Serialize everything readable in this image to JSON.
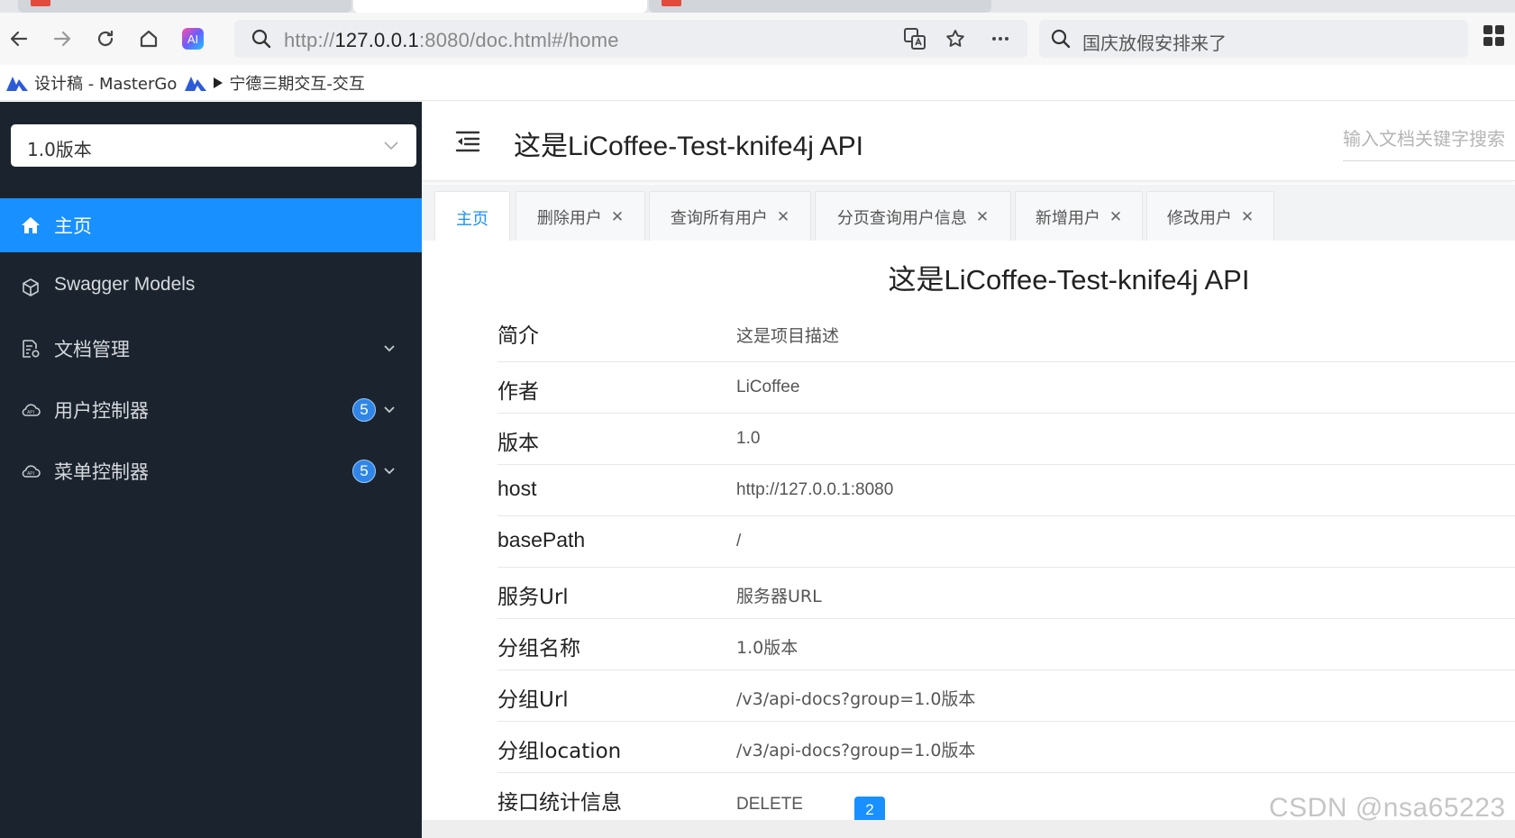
{
  "browser": {
    "url_prefix": "http://",
    "url_host": "127.0.0.1",
    "url_rest": ":8080/doc.html#/home",
    "search_text": "国庆放假安排来了",
    "extension_icon": "ai-extension-icon",
    "bookmarks": [
      {
        "label": "设计稿 - MasterGo",
        "icon": "mastergo-logo"
      },
      {
        "label": "宁德三期交互-交互",
        "icon": "mastergo-logo"
      }
    ]
  },
  "sidebar": {
    "version_select": "1.0版本",
    "items": [
      {
        "label": "主页",
        "icon": "home-icon",
        "active": true
      },
      {
        "label": "Swagger Models",
        "icon": "cube-icon"
      },
      {
        "label": "文档管理",
        "icon": "doc-settings-icon",
        "expandable": true
      },
      {
        "label": "用户控制器",
        "icon": "cloud-api-icon",
        "badge": "5",
        "expandable": true
      },
      {
        "label": "菜单控制器",
        "icon": "cloud-api-icon",
        "badge": "5",
        "expandable": true
      }
    ]
  },
  "header": {
    "title": "这是LiCoffee-Test-knife4j API",
    "search_placeholder": "输入文档关键字搜索"
  },
  "tabs": [
    {
      "label": "主页",
      "active": true
    },
    {
      "label": "删除用户",
      "closable": true
    },
    {
      "label": "查询所有用户",
      "closable": true
    },
    {
      "label": "分页查询用户信息",
      "closable": true
    },
    {
      "label": "新增用户",
      "closable": true
    },
    {
      "label": "修改用户",
      "closable": true
    }
  ],
  "content": {
    "title": "这是LiCoffee-Test-knife4j API",
    "rows": [
      {
        "key": "简介",
        "value": "这是项目描述"
      },
      {
        "key": "作者",
        "value": "LiCoffee"
      },
      {
        "key": "版本",
        "value": "1.0"
      },
      {
        "key": "host",
        "value": "http://127.0.0.1:8080"
      },
      {
        "key": "basePath",
        "value": "/"
      },
      {
        "key": "服务Url",
        "value": "服务器URL"
      },
      {
        "key": "分组名称",
        "value": "1.0版本"
      },
      {
        "key": "分组Url",
        "value": "/v3/api-docs?group=1.0版本"
      },
      {
        "key": "分组location",
        "value": "/v3/api-docs?group=1.0版本"
      },
      {
        "key": "接口统计信息",
        "value": "DELETE",
        "count": "2"
      }
    ]
  },
  "watermark": "CSDN @nsa65223",
  "colors": {
    "sidebar_bg": "#1b242e",
    "active_item": "#1890ff",
    "badge": "#2f86e8"
  }
}
